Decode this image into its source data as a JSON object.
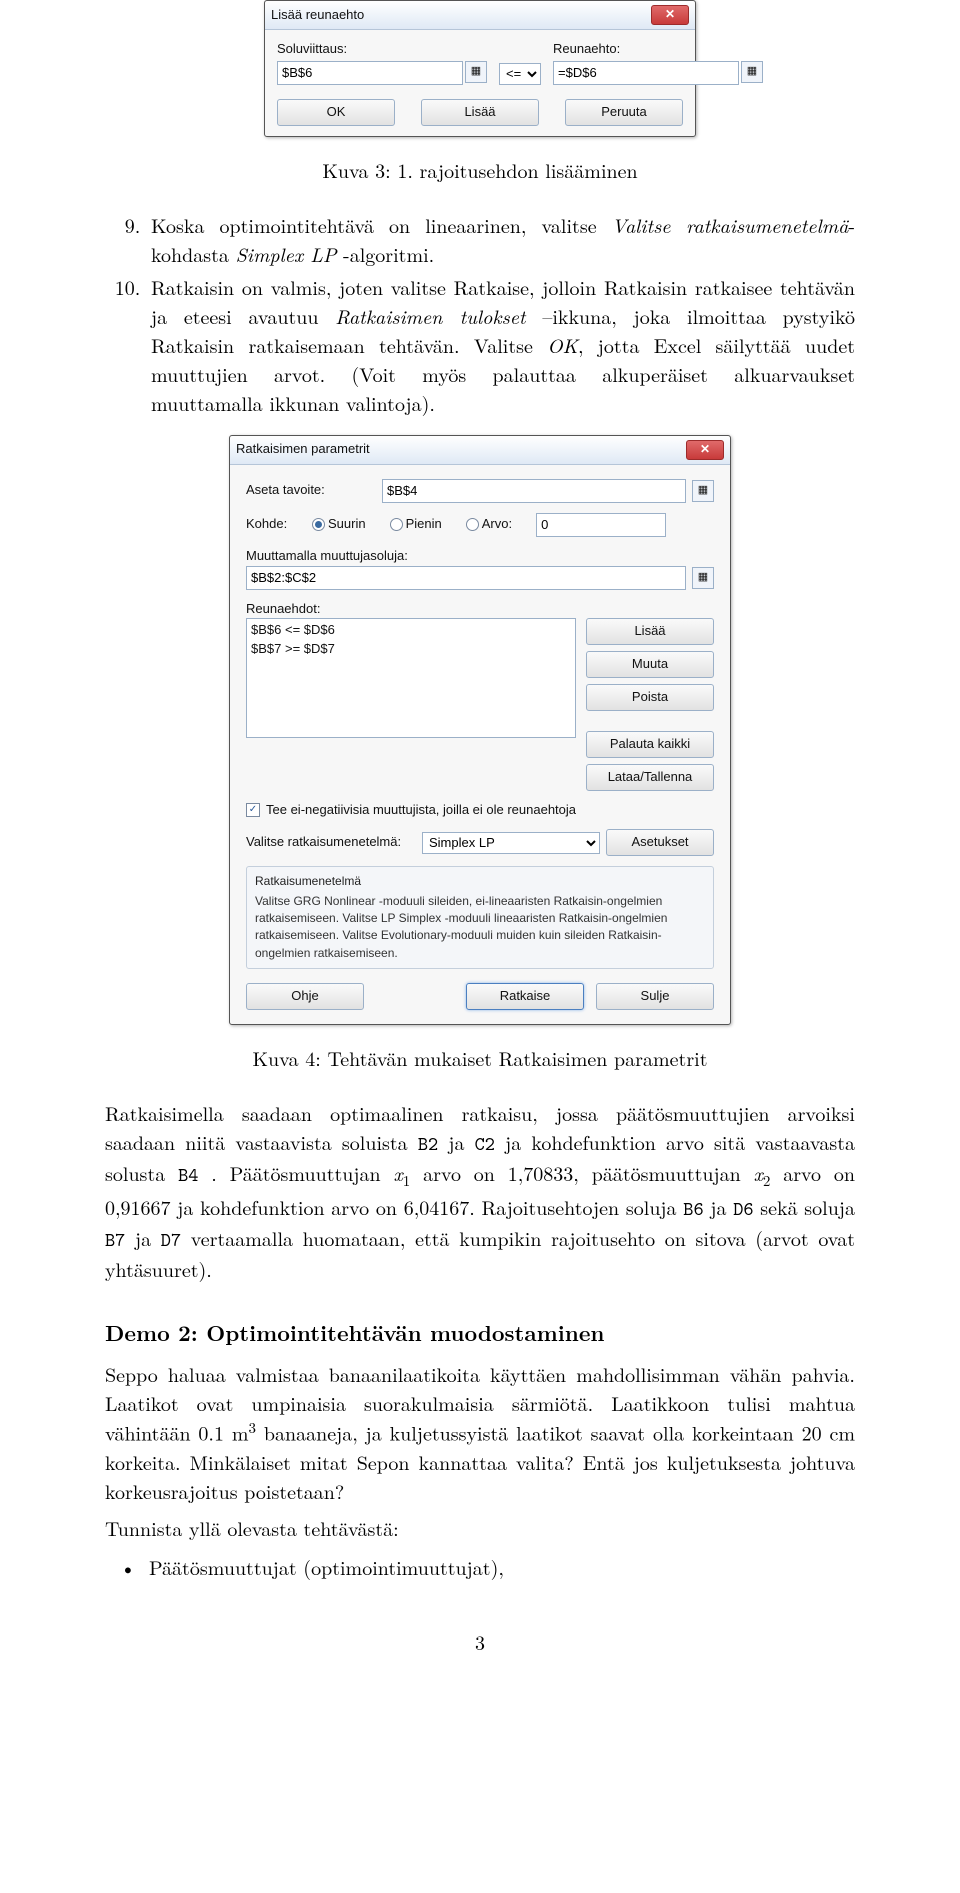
{
  "dlg1": {
    "title": "Lisää reunaehto",
    "label_cellref": "Soluviittaus:",
    "value_cellref": "$B$6",
    "operator": "<=",
    "label_constraint": "Reunaehto:",
    "value_constraint": "=$D$6",
    "btn_ok": "OK",
    "btn_add": "Lisää",
    "btn_cancel": "Peruuta"
  },
  "caption1": "Kuva 3: 1. rajoitusehdon lisääminen",
  "step9": {
    "num": "9.",
    "pre": "Koska optimointitehtävä on lineaarinen, valitse ",
    "it1": "Valitse ratkaisumenetelmä",
    "mid": "-kohdasta ",
    "it2": "Simplex LP",
    "post": " -algoritmi."
  },
  "step10": {
    "num": "10.",
    "p1": "Ratkaisin on valmis, joten valitse Ratkaise, jolloin Ratkaisin ratkaisee tehtävän ja eteesi avautuu ",
    "it1": "Ratkaisimen tulokset",
    "p2": " –ikkuna, joka ilmoittaa pystyikö Ratkaisin ratkaisemaan tehtävän. Valitse ",
    "it2": "OK",
    "p3": ", jotta Excel säilyttää uudet muuttujien arvot. (Voit myös palauttaa alkuperäiset alkuarvaukset muuttamalla ikkunan valintoja)."
  },
  "dlg2": {
    "title": "Ratkaisimen parametrit",
    "lbl_target": "Aseta tavoite:",
    "val_target": "$B$4",
    "lbl_kohde": "Kohde:",
    "radio_max": "Suurin",
    "radio_min": "Pienin",
    "radio_val": "Arvo:",
    "val_arvo": "0",
    "lbl_changing": "Muuttamalla muuttujasoluja:",
    "val_changing": "$B$2:$C$2",
    "lbl_constraints": "Reunaehdot:",
    "constraints": [
      "$B$6 <= $D$6",
      "$B$7 >= $D$7"
    ],
    "btn_add": "Lisää",
    "btn_change": "Muuta",
    "btn_delete": "Poista",
    "btn_resetall": "Palauta kaikki",
    "btn_loadsave": "Lataa/Tallenna",
    "chk_nonneg": "Tee ei-negatiivisia muuttujista, joilla ei ole reunaehtoja",
    "lbl_method": "Valitse ratkaisumenetelmä:",
    "val_method": "Simplex LP",
    "btn_options": "Asetukset",
    "desc_title": "Ratkaisumenetelmä",
    "desc_body": "Valitse GRG Nonlinear -moduuli sileiden, ei-lineaaristen Ratkaisin-ongelmien ratkaisemiseen. Valitse LP Simplex -moduuli lineaaristen Ratkaisin-ongelmien ratkaisemiseen. Valitse Evolutionary-moduuli muiden kuin sileiden Ratkaisin-ongelmien ratkaisemiseen.",
    "btn_help": "Ohje",
    "btn_solve": "Ratkaise",
    "btn_close": "Sulje"
  },
  "caption2": "Kuva 4: Tehtävän mukaiset Ratkaisimen parametrit",
  "resultpara": {
    "a": "Ratkaisimella saadaan optimaalinen ratkaisu, jossa päätösmuuttujien arvoiksi saadaan niitä vastaavista soluista ",
    "b2": "B2",
    "b": " ja ",
    "c2": "C2",
    "c": " ja kohdefunktion arvo sitä vastaavasta solusta ",
    "b4": "B4",
    "d": " . Päätösmuuttujan ",
    "x1": "x",
    "x1sub": "1",
    "e": " arvo on 1,70833, päätösmuuttujan ",
    "x2": "x",
    "x2sub": "2",
    "f": " arvo on 0,91667 ja kohdefunktion arvo on 6,04167. Rajoitusehtojen soluja ",
    "b6": "B6",
    "g": " ja ",
    "d6": "D6",
    "h": " sekä soluja ",
    "b7": "B7",
    "i": " ja ",
    "d7": "D7",
    "j": " vertaamalla huomataan, että kumpikin rajoitusehto on sitova (arvot ovat yhtäsuuret)."
  },
  "demo2": {
    "heading": "Demo 2: Optimointitehtävän muodostaminen",
    "p1a": "Seppo haluaa valmistaa banaanilaatikoita käyttäen mahdollisimman vähän pahvia. Laatikot ovat umpinaisia suorakulmaisia särmiötä. Laatikkoon tulisi mahtua vähintään 0.1 m",
    "p1sup": "3",
    "p1b": " banaaneja, ja kuljetussyistä laatikot saavat olla korkeintaan 20 cm korkeita. Minkälaiset mitat Sepon kannattaa valita? Entä jos kuljetuksesta johtuva korkeusrajoitus poistetaan?",
    "p2": "Tunnista yllä olevasta tehtävästä:",
    "bullet1": "Päätösmuuttujat (optimointimuuttujat),"
  },
  "pagenum": "3"
}
